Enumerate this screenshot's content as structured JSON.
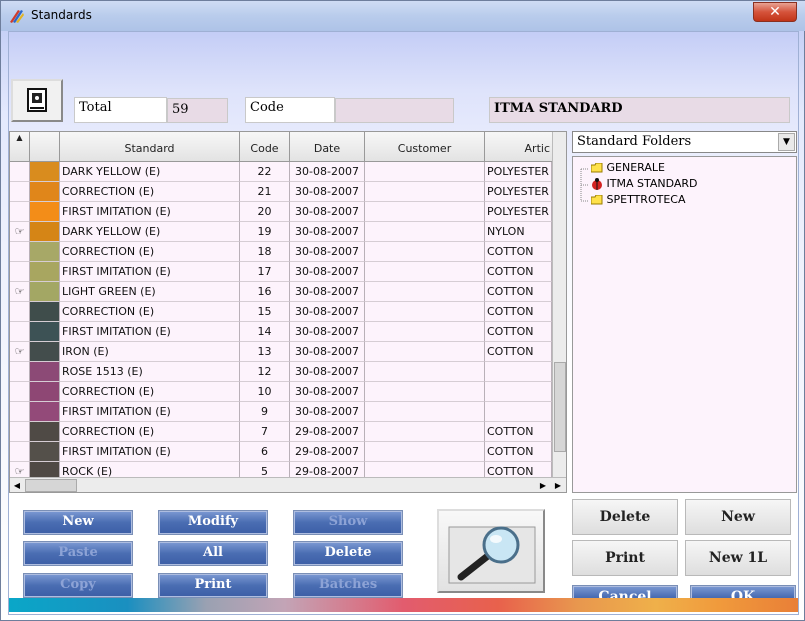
{
  "window": {
    "title": "Standards",
    "close_label": "✕"
  },
  "summary": {
    "total_label": "Total",
    "total_value": "59",
    "code_label": "Code",
    "code_value": "",
    "folder_value": "ITMA STANDARD"
  },
  "grid": {
    "columns": [
      "Standard",
      "Code",
      "Date",
      "Customer",
      "Artic"
    ],
    "rows": [
      {
        "color": "#d98c1e",
        "hand": false,
        "standard": "DARK YELLOW  (E)",
        "code": "22",
        "date": "30-08-2007",
        "customer": "",
        "article": "POLYESTER"
      },
      {
        "color": "#e0861a",
        "hand": false,
        "standard": "CORRECTION (E)",
        "code": "21",
        "date": "30-08-2007",
        "customer": "",
        "article": "POLYESTER"
      },
      {
        "color": "#f38d18",
        "hand": false,
        "standard": "FIRST IMITATION (E)",
        "code": "20",
        "date": "30-08-2007",
        "customer": "",
        "article": "POLYESTER"
      },
      {
        "color": "#d58516",
        "hand": true,
        "standard": "DARK YELLOW (E)",
        "code": "19",
        "date": "30-08-2007",
        "customer": "",
        "article": "NYLON"
      },
      {
        "color": "#a7a867",
        "hand": false,
        "standard": "CORRECTION (E)",
        "code": "18",
        "date": "30-08-2007",
        "customer": "",
        "article": "COTTON"
      },
      {
        "color": "#a8a660",
        "hand": false,
        "standard": "FIRST IMITATION (E)",
        "code": "17",
        "date": "30-08-2007",
        "customer": "",
        "article": "COTTON"
      },
      {
        "color": "#a3a764",
        "hand": true,
        "standard": "LIGHT GREEN (E)",
        "code": "16",
        "date": "30-08-2007",
        "customer": "",
        "article": "COTTON"
      },
      {
        "color": "#3f4d4b",
        "hand": false,
        "standard": "CORRECTION (E)",
        "code": "15",
        "date": "30-08-2007",
        "customer": "",
        "article": "COTTON"
      },
      {
        "color": "#3d5255",
        "hand": false,
        "standard": "FIRST IMITATION (E)",
        "code": "14",
        "date": "30-08-2007",
        "customer": "",
        "article": "COTTON"
      },
      {
        "color": "#434d4c",
        "hand": true,
        "standard": "IRON (E)",
        "code": "13",
        "date": "30-08-2007",
        "customer": "",
        "article": "COTTON"
      },
      {
        "color": "#8c4a76",
        "hand": false,
        "standard": "ROSE 1513 (E)",
        "code": "12",
        "date": "30-08-2007",
        "customer": "",
        "article": ""
      },
      {
        "color": "#8e4774",
        "hand": false,
        "standard": "CORRECTION (E)",
        "code": "10",
        "date": "30-08-2007",
        "customer": "",
        "article": ""
      },
      {
        "color": "#934a79",
        "hand": false,
        "standard": "FIRST IMITATION (E)",
        "code": "9",
        "date": "30-08-2007",
        "customer": "",
        "article": ""
      },
      {
        "color": "#4f4a45",
        "hand": false,
        "standard": "CORRECTION (E)",
        "code": "7",
        "date": "29-08-2007",
        "customer": "",
        "article": "COTTON"
      },
      {
        "color": "#54504a",
        "hand": false,
        "standard": "FIRST IMITATION (E)",
        "code": "6",
        "date": "29-08-2007",
        "customer": "",
        "article": "COTTON"
      },
      {
        "color": "#4f4944",
        "hand": true,
        "standard": "ROCK (E)",
        "code": "5",
        "date": "29-08-2007",
        "customer": "",
        "article": "COTTON"
      }
    ]
  },
  "folders": {
    "dropdown_value": "Standard Folders",
    "items": [
      "GENERALE",
      "ITMA STANDARD",
      "SPETTROTECA"
    ]
  },
  "buttons": {
    "new": "New",
    "modify": "Modify",
    "show": "Show",
    "paste": "Paste",
    "all": "All",
    "delete": "Delete",
    "copy": "Copy",
    "print": "Print",
    "batches": "Batches"
  },
  "folder_buttons": {
    "delete": "Delete",
    "new": "New",
    "print": "Print",
    "new1l": "New 1L",
    "cancel": "Cancel",
    "ok": "OK"
  }
}
